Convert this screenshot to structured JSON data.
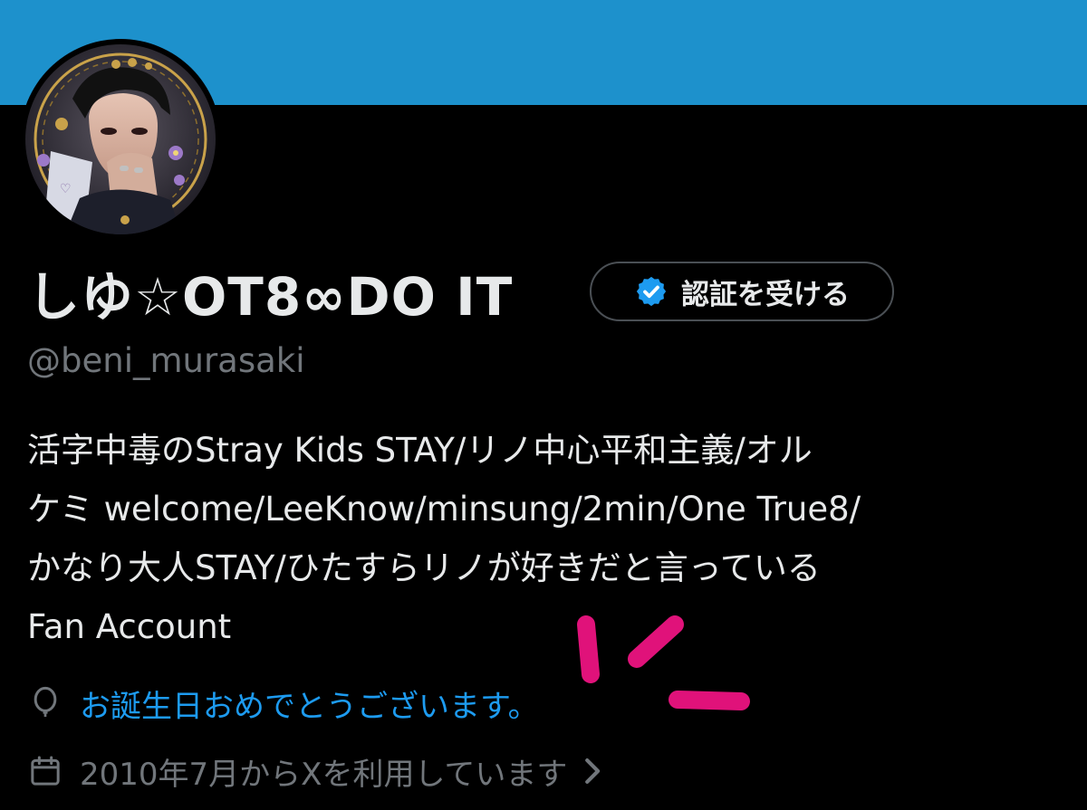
{
  "profile": {
    "display_name": "しゆ☆OT8∞DO IT",
    "handle": "@beni_murasaki",
    "verify_button_label": "認証を受ける",
    "bio_lines": [
      "活字中毒のStray Kids STAY/リノ中心平和主義/オル",
      "ケミ welcome/LeeKnow/minsung/2min/One True8/",
      "かなり大人STAY/ひたすらリノが好きだと言っている",
      "Fan Account"
    ],
    "birthday_text": "お誕生日おめでとうございます。",
    "joined_text": "2010年7月からXを利用しています"
  },
  "icons": {
    "verify": "verified-badge-icon",
    "birthday": "balloon-icon",
    "joined": "calendar-icon",
    "more": "chevron-right-icon"
  },
  "colors": {
    "banner": "#1d91cc",
    "background": "#000000",
    "primary_text": "#e7e9ea",
    "secondary_text": "#71767b",
    "link": "#1d9bf0",
    "annotation": "#e0127a"
  }
}
